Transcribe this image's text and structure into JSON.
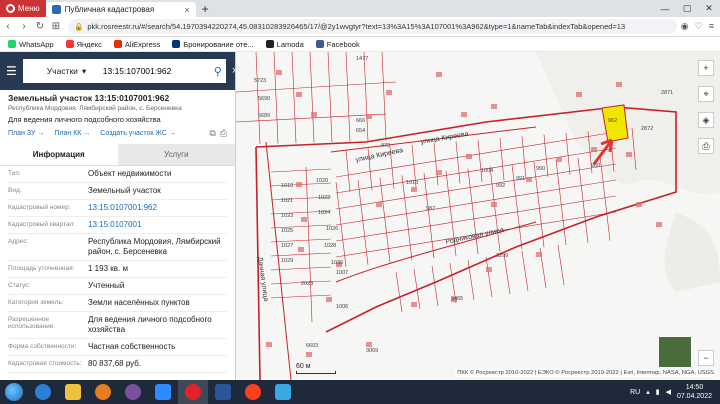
{
  "browser": {
    "menu_label": "Меню",
    "tab_title": "Публичная кадастровая",
    "url": "pkk.rosreestr.ru/#/search/54.1970394220274,45.08310283926465/17/@2y1wvgtyr?text=13%3A15%3A107001%3A962&type=1&nameTab&indexTab&opened=13"
  },
  "bookmarks": [
    {
      "label": "WhatsApp",
      "color": "#25d366"
    },
    {
      "label": "Яндекс",
      "color": "#f33"
    },
    {
      "label": "AliExpress",
      "color": "#e62e04"
    },
    {
      "label": "Бронирование оте...",
      "color": "#003580"
    },
    {
      "label": "Lamoda",
      "color": "#222"
    },
    {
      "label": "Facebook",
      "color": "#3b5998"
    }
  ],
  "search": {
    "type_label": "Участки",
    "query": "13:15:107001:962"
  },
  "parcel": {
    "title": "Земельный участок 13:15:0107001:962",
    "address_short": "Республика Мордовия, Лямбирский район, с. Берсеневка",
    "purpose": "Для ведения личного подсобного хозяйства",
    "links": [
      "План ЗУ →",
      "План КК →",
      "Создать участок ЖС →"
    ]
  },
  "tabs": {
    "info": "Информация",
    "services": "Услуги"
  },
  "rows": [
    {
      "k": "Тип:",
      "v": "Объект недвижимости",
      "link": false
    },
    {
      "k": "Вид:",
      "v": "Земельный участок",
      "link": false
    },
    {
      "k": "Кадастровый номер:",
      "v": "13:15:0107001:962",
      "link": true
    },
    {
      "k": "Кадастровый квартал:",
      "v": "13:15:0107001",
      "link": true
    },
    {
      "k": "Адрес:",
      "v": "Республика Мордовия, Лямбирский район, с. Берсеневка",
      "link": false
    },
    {
      "k": "Площадь уточненная:",
      "v": "1 193 кв. м",
      "link": false
    },
    {
      "k": "Статус:",
      "v": "Учтенный",
      "link": false
    },
    {
      "k": "Категория земель:",
      "v": "Земли населённых пунктов",
      "link": false
    },
    {
      "k": "Разрешенное использование:",
      "v": "Для ведения личного подсобного хозяйства",
      "link": false
    },
    {
      "k": "Форма собственности:",
      "v": "Частная собственность",
      "link": false
    },
    {
      "k": "Кадастровая стоимость:",
      "v": "80 837,68 руб.",
      "link": false
    }
  ],
  "map": {
    "streets": [
      "улица Киреева",
      "улица Киреева",
      "Дачная улица",
      "Родниковая улица"
    ],
    "scale_label": "60 м",
    "copyright": "ПКК © Росреестр 2010-2022 | ЕЭКО © Росреестр 2019-2022 | Esri, Intermap, NASA, NGA, USGS",
    "parcel_labels": [
      "5723",
      "5690",
      "5689",
      "1477",
      "1019",
      "1020",
      "1021",
      "1022",
      "1023",
      "1024",
      "1025",
      "1026",
      "1027",
      "1028",
      "1029",
      "1030",
      "2023",
      "1007",
      "1006",
      "6603",
      "3069",
      "3465",
      "3299",
      "992",
      "987",
      "991",
      "990",
      "2872",
      "2871",
      "962",
      "666",
      "654",
      "973",
      "960",
      "1013",
      "1004"
    ]
  },
  "taskbar": {
    "lang": "RU",
    "time": "14:50",
    "date": "07.04.2022"
  }
}
